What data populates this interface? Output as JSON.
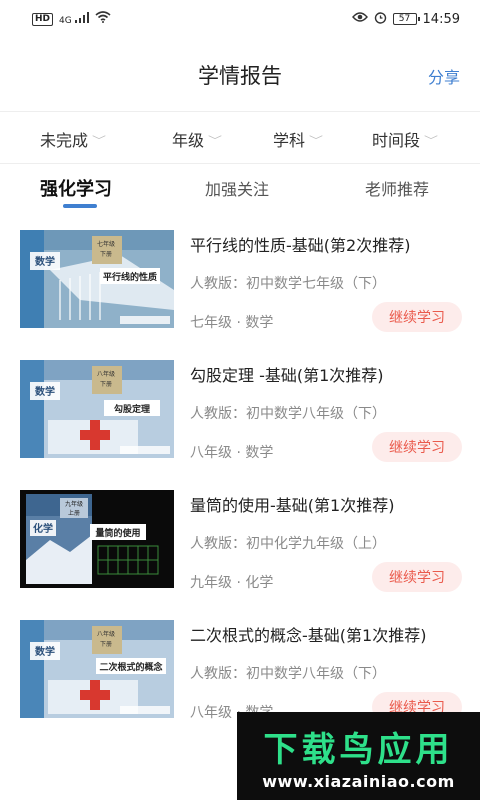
{
  "status_bar": {
    "hd": "HD",
    "signal": "4G",
    "time": "14:59",
    "battery": "57"
  },
  "header": {
    "title": "学情报告",
    "share": "分享"
  },
  "filters": [
    {
      "label": "未完成"
    },
    {
      "label": "年级"
    },
    {
      "label": "学科"
    },
    {
      "label": "时间段"
    }
  ],
  "tabs": [
    {
      "label": "强化学习",
      "active": true
    },
    {
      "label": "加强关注",
      "active": false
    },
    {
      "label": "老师推荐",
      "active": false
    }
  ],
  "items": [
    {
      "title": "平行线的性质-基础(第2次推荐)",
      "edition": "人教版：初中数学七年级（下）",
      "meta": "七年级 · 数学",
      "action": "继续学习",
      "cover_subject": "数学",
      "cover_topic": "平行线的性质",
      "cover_grade": "七年级",
      "cover_term": "下册"
    },
    {
      "title": "勾股定理 -基础(第1次推荐)",
      "edition": "人教版：初中数学八年级（下）",
      "meta": "八年级 · 数学",
      "action": "继续学习",
      "cover_subject": "数学",
      "cover_topic": "勾股定理",
      "cover_grade": "八年级",
      "cover_term": "下册"
    },
    {
      "title": "量筒的使用-基础(第1次推荐)",
      "edition": "人教版：初中化学九年级（上）",
      "meta": "九年级 · 化学",
      "action": "继续学习",
      "cover_subject": "化学",
      "cover_topic": "量筒的使用",
      "cover_grade": "九年级",
      "cover_term": "上册"
    },
    {
      "title": "二次根式的概念-基础(第1次推荐)",
      "edition": "人教版：初中数学八年级（下）",
      "meta": "八年级 · 数学",
      "action": "继续学习",
      "cover_subject": "数学",
      "cover_topic": "二次根式的概念",
      "cover_grade": "八年级",
      "cover_term": "下册"
    }
  ],
  "watermark": {
    "brand": "下载鸟应用",
    "url": "www.xiazainiao.com"
  },
  "colors": {
    "accent": "#3f7fd0",
    "button_bg": "#fdeceb",
    "button_text": "#ea5a4c"
  }
}
